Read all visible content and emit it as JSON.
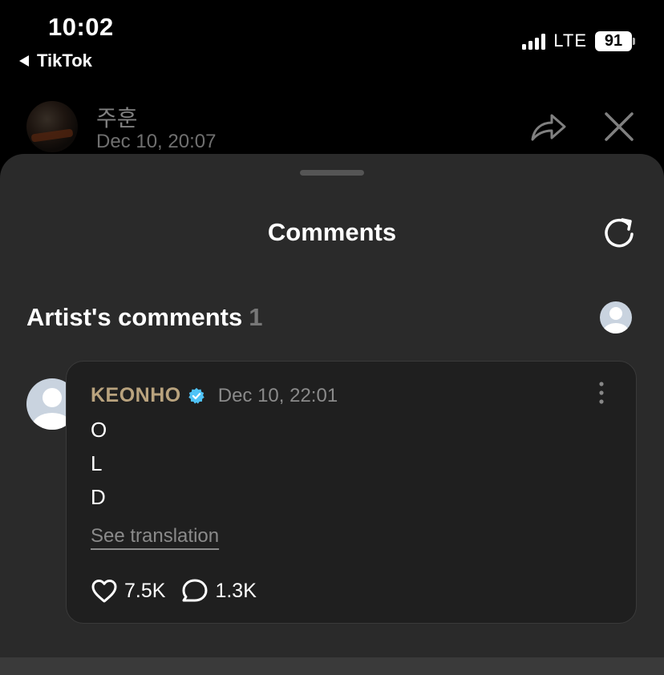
{
  "status_bar": {
    "time": "10:02",
    "back_app": "TikTok",
    "network": "LTE",
    "battery": "91"
  },
  "post": {
    "author_name": "주훈",
    "date": "Dec 10, 20:07"
  },
  "sheet": {
    "title": "Comments",
    "section_title": "Artist's comments",
    "section_count": "1"
  },
  "comment": {
    "author": "KEONHO",
    "date": "Dec 10, 22:01",
    "lines": [
      "O",
      "L",
      "D"
    ],
    "translate_label": "See translation",
    "likes": "7.5K",
    "replies": "1.3K"
  },
  "colors": {
    "author_gold": "#b9a37e",
    "verified_blue": "#4fc3f7",
    "sheet_bg": "#2a2a2a",
    "card_bg": "#1f1f1f"
  }
}
